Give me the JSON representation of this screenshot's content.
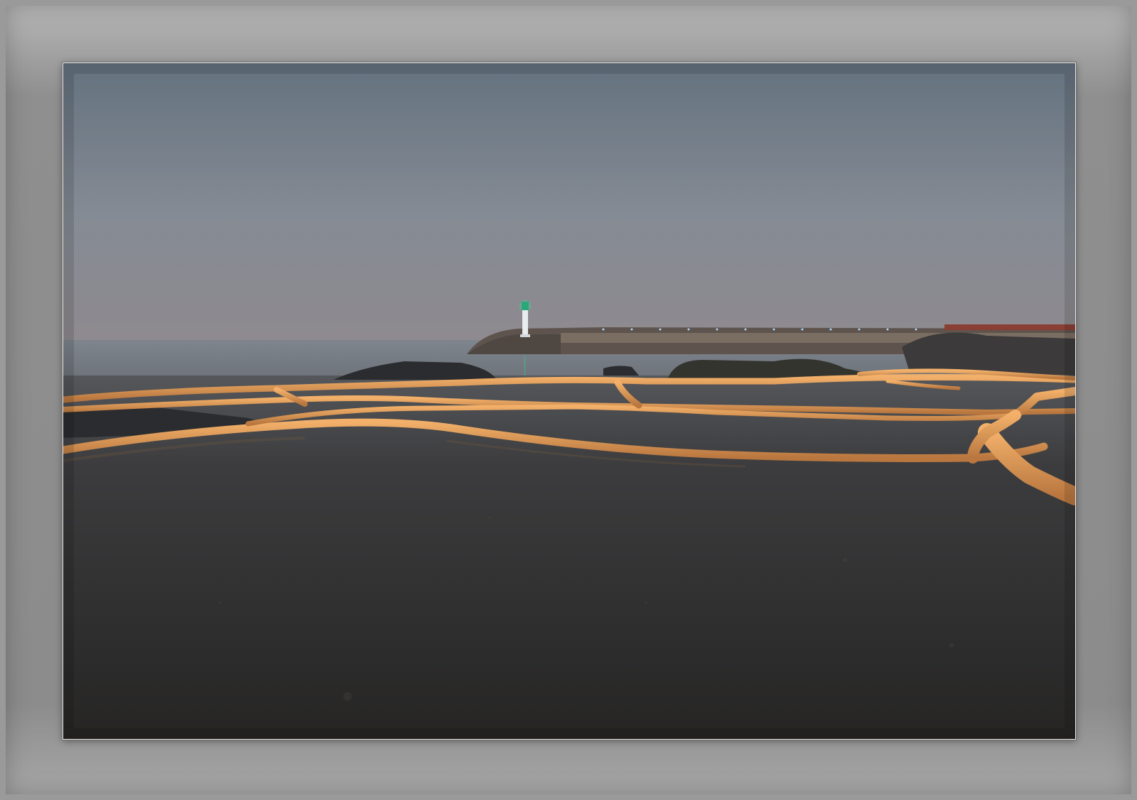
{
  "scene": {
    "subject": "lighthouse-breakwater-tidal-pools",
    "colors": {
      "sky_top": "#64727f",
      "sky_mid": "#858b94",
      "sky_horizon": "#8e8a8f",
      "sea": "#7b818a",
      "water_near": "#2d2d2e",
      "rim_light": "#d4914f",
      "rim_highlight": "#f0ad63",
      "breakwater": "#6a5f57",
      "lighthouse_light": "#29c48b",
      "mat": "#8c8c8c"
    }
  }
}
